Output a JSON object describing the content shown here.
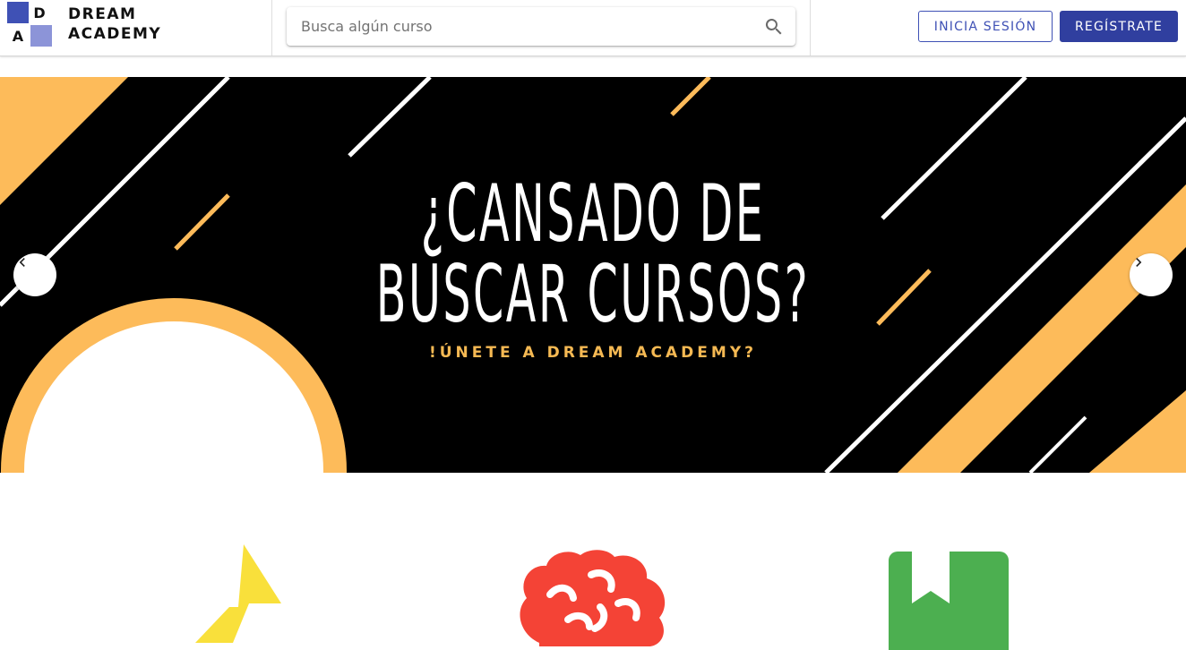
{
  "brand": {
    "logo_letters": [
      "D",
      "A"
    ],
    "name_line1": "DREAM",
    "name_line2": "ACADEMY",
    "colors": {
      "dark_square": "#3f51b5",
      "light_square": "#8c94d8"
    }
  },
  "search": {
    "placeholder": "Busca algún curso",
    "value": "",
    "icon": "search-icon"
  },
  "auth": {
    "login_label": "INICIA SESIÓN",
    "register_label": "REGÍSTRATE"
  },
  "hero": {
    "headline_line1": "¿CANSADO DE",
    "headline_line2": "BUSCAR CURSOS?",
    "subheadline": "!ÚNETE A DREAM ACADEMY?",
    "prev_icon": "chevron-left-icon",
    "next_icon": "chevron-right-icon",
    "colors": {
      "background": "#000000",
      "accent": "#fdbb5a",
      "stripe": "#ffffff"
    }
  },
  "features": {
    "icons": [
      {
        "icon": "lightning-icon",
        "color": "#f9e03b"
      },
      {
        "icon": "brain-icon",
        "color": "#f44336"
      },
      {
        "icon": "bookmark-book-icon",
        "color": "#4caf50"
      }
    ]
  },
  "colors": {
    "primary": "#303f9f",
    "primary_outline": "#3f51b5"
  }
}
